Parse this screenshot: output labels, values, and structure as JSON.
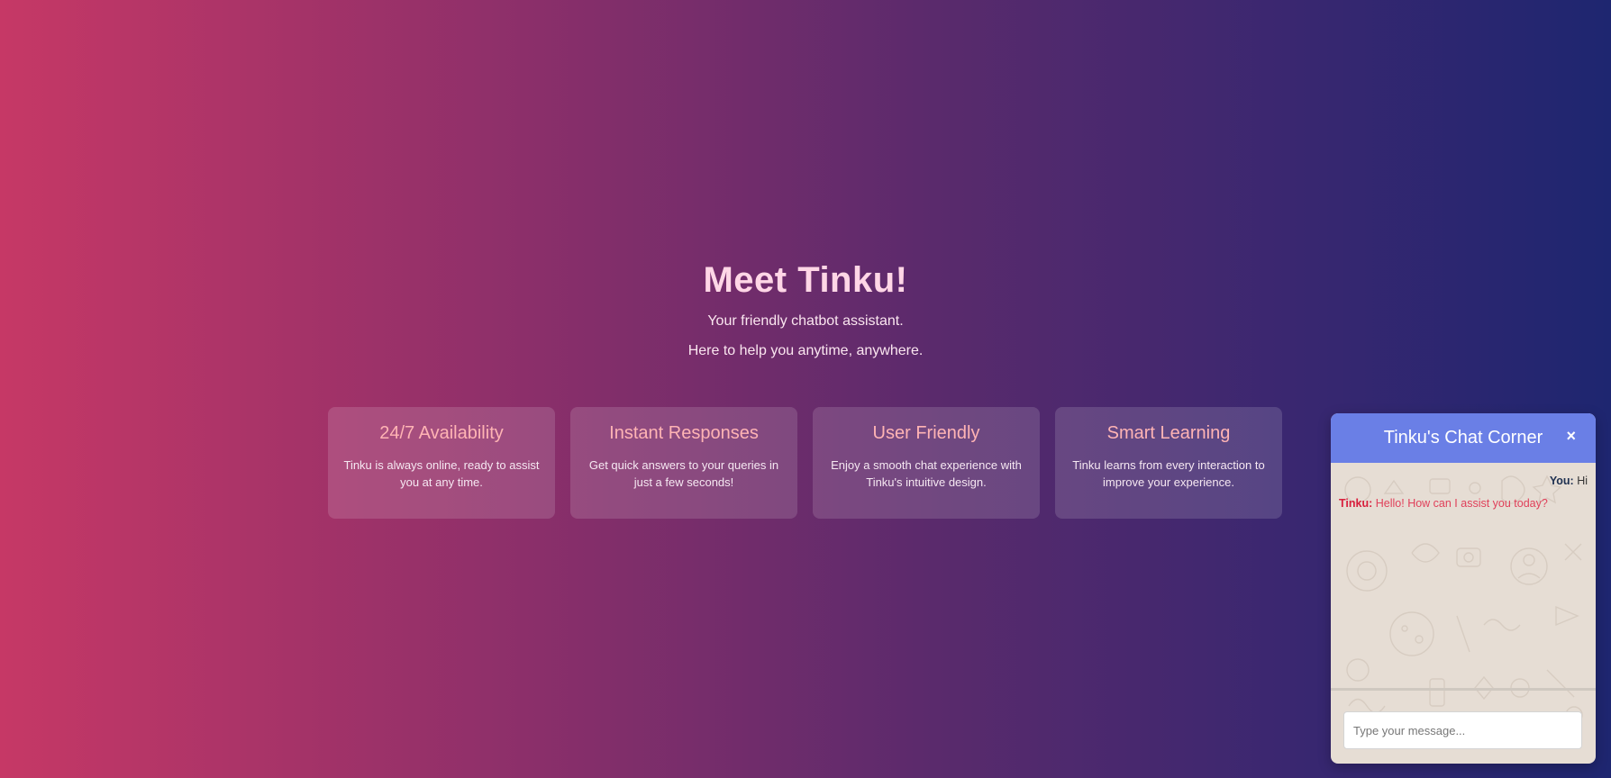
{
  "hero": {
    "title": "Meet Tinku!",
    "subtitle_1": "Your friendly chatbot assistant.",
    "subtitle_2": "Here to help you anytime, anywhere."
  },
  "features": [
    {
      "title": "24/7 Availability",
      "text": "Tinku is always online, ready to assist you at any time."
    },
    {
      "title": "Instant Responses",
      "text": "Get quick answers to your queries in just a few seconds!"
    },
    {
      "title": "User Friendly",
      "text": "Enjoy a smooth chat experience with Tinku's intuitive design."
    },
    {
      "title": "Smart Learning",
      "text": "Tinku learns from every interaction to improve your experience."
    }
  ],
  "chat": {
    "title": "Tinku's Chat Corner",
    "close_icon": "close-icon",
    "close_glyph": "×",
    "messages": [
      {
        "sender": "You:",
        "text": "Hi"
      },
      {
        "sender": "Tinku:",
        "text": "Hello! How can I assist you today?"
      }
    ],
    "input_placeholder": "Type your message...",
    "input_value": ""
  },
  "colors": {
    "gradient_left": "#c63866",
    "gradient_right": "#1e2670",
    "chat_header": "#6a7fe6",
    "feature_title": "#ffb4b4",
    "bot_text": "#e0405a"
  }
}
